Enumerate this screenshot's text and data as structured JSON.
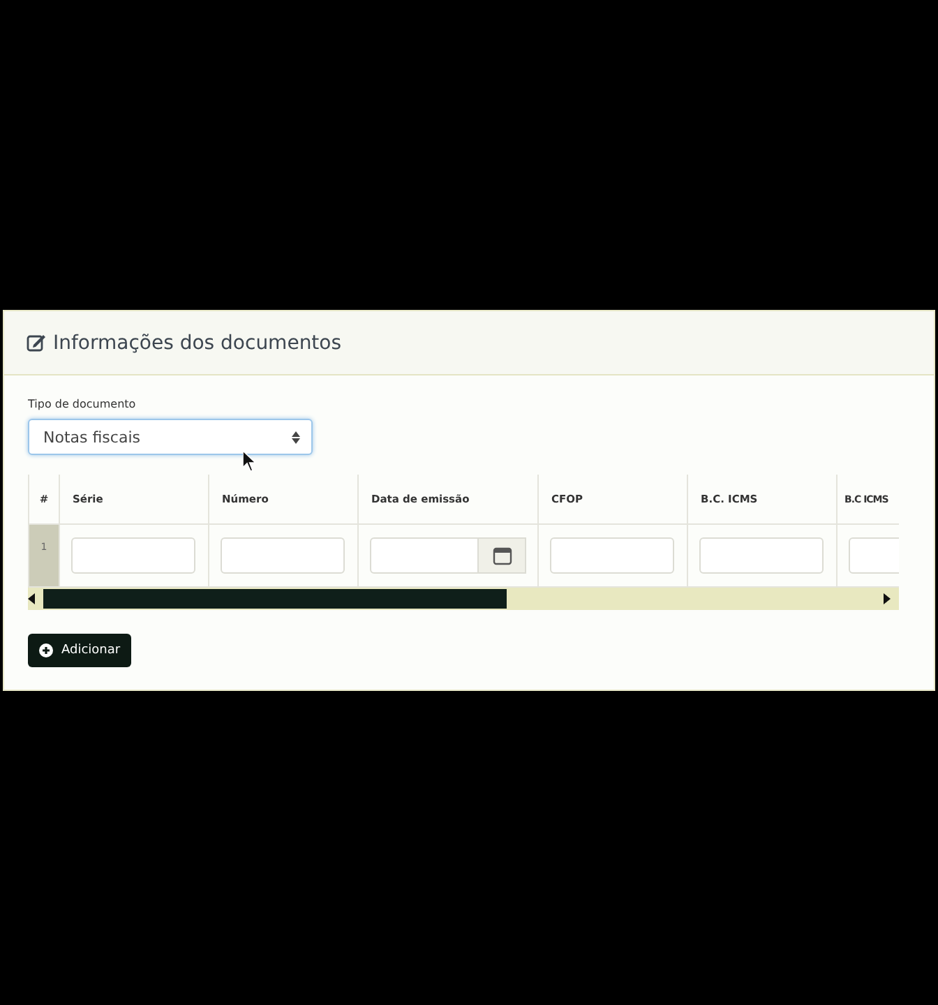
{
  "panel": {
    "title": "Informações dos documentos"
  },
  "document_type": {
    "label": "Tipo de documento",
    "value": "Notas fiscais"
  },
  "table": {
    "columns": [
      "#",
      "Série",
      "Número",
      "Data de emissão",
      "CFOP",
      "B.C. ICMS",
      "B.C ICMS"
    ],
    "rows": [
      {
        "number": "1",
        "cells": [
          {
            "kind": "text"
          },
          {
            "kind": "text"
          },
          {
            "kind": "date"
          },
          {
            "kind": "text"
          },
          {
            "kind": "text"
          },
          {
            "kind": "text"
          }
        ]
      }
    ]
  },
  "add_button": {
    "label": "Adicionar"
  }
}
